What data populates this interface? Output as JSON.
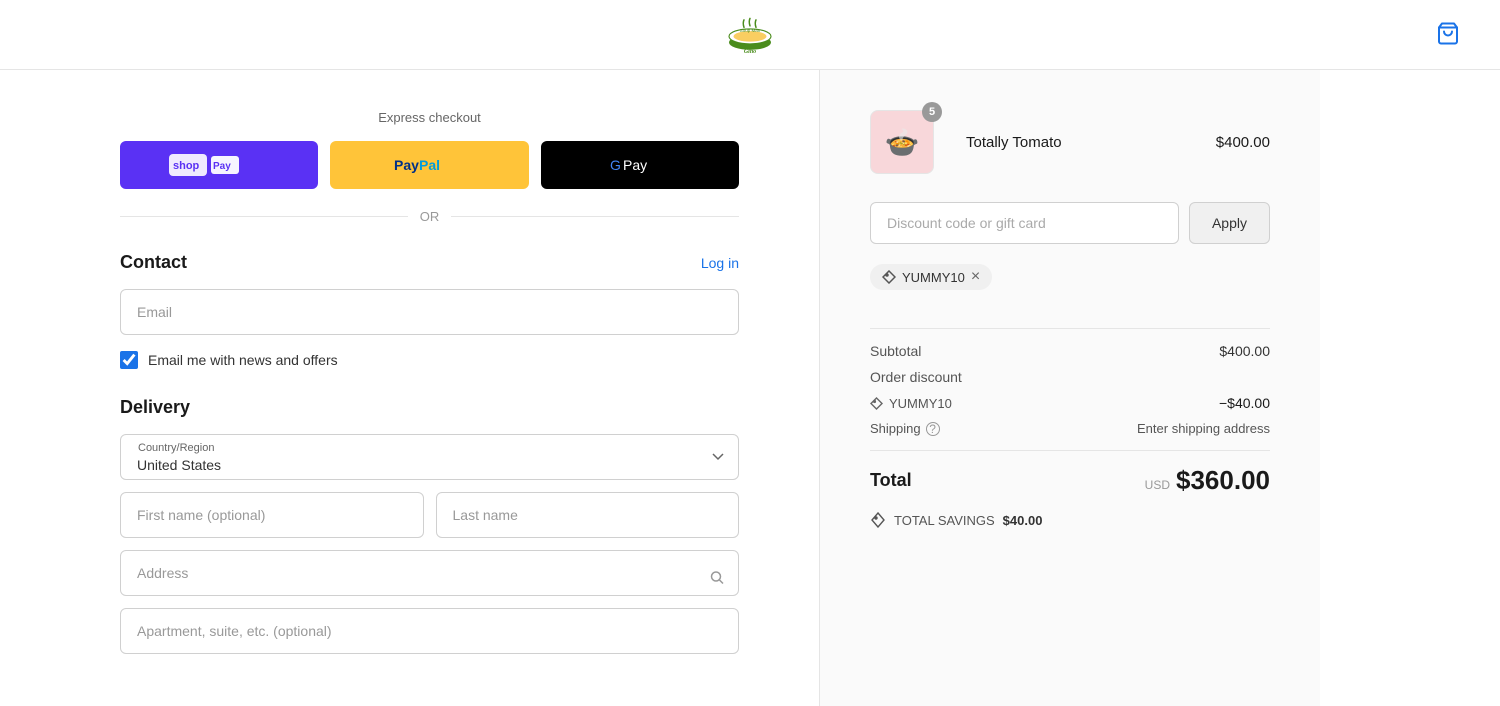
{
  "header": {
    "logo_alt": "Gino Soup Man",
    "cart_icon": "shopping-bag"
  },
  "express_checkout": {
    "label": "Express checkout",
    "divider": "OR",
    "shop_pay_label": "Shop Pay",
    "paypal_label": "PayPal",
    "gpay_label": "G Pay"
  },
  "contact": {
    "title": "Contact",
    "log_in_label": "Log in",
    "email_placeholder": "Email",
    "newsletter_label": "Email me with news and offers",
    "newsletter_checked": true
  },
  "delivery": {
    "title": "Delivery",
    "country_label": "Country/Region",
    "country_value": "United States",
    "first_name_placeholder": "First name (optional)",
    "last_name_placeholder": "Last name",
    "address_placeholder": "Address",
    "apt_placeholder": "Apartment, suite, etc. (optional)"
  },
  "order_summary": {
    "product": {
      "name": "Totally Tomato",
      "price": "$400.00",
      "quantity": "5",
      "emoji": "🍲"
    },
    "discount_placeholder": "Discount code or gift card",
    "apply_label": "Apply",
    "applied_code": "YUMMY10",
    "subtotal_label": "Subtotal",
    "subtotal_amount": "$400.00",
    "order_discount_label": "Order discount",
    "discount_code_display": "YUMMY10",
    "discount_amount": "−$40.00",
    "shipping_label": "Shipping",
    "shipping_value": "Enter shipping address",
    "total_label": "Total",
    "total_currency": "USD",
    "total_amount": "$360.00",
    "savings_label": "TOTAL SAVINGS",
    "savings_amount": "$40.00"
  }
}
